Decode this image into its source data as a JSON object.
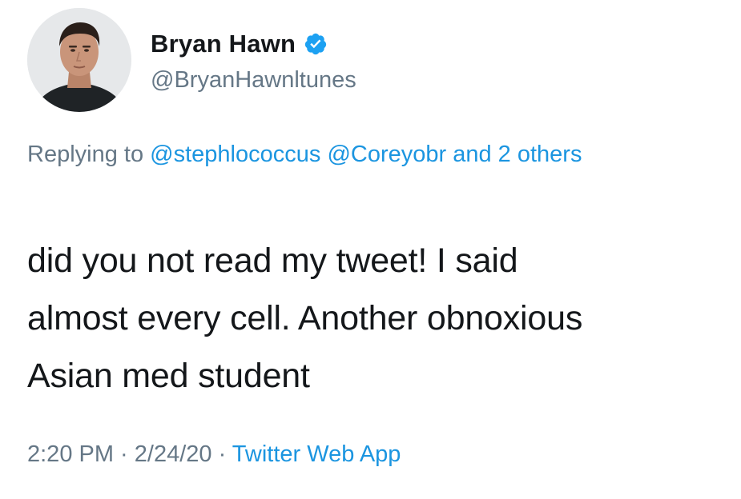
{
  "author": {
    "display_name": "Bryan Hawn",
    "handle": "@BryanHawnltunes",
    "verified": true,
    "avatar_icon": "profile-photo"
  },
  "reply_context": {
    "prefix": "Replying to ",
    "mention_1": "@stephlococcus",
    "mention_2": "@Coreyobr",
    "others": "and 2 others"
  },
  "tweet": {
    "line_1": "did you not read my tweet! I said",
    "line_2": "almost every cell. Another obnoxious",
    "line_3": "Asian med student"
  },
  "meta": {
    "time": "2:20 PM",
    "separator": " · ",
    "date": "2/24/20",
    "source": "Twitter Web App"
  },
  "colors": {
    "link": "#1b95e0",
    "secondary_text": "#657786",
    "primary_text": "#14171a",
    "verified_badge": "#1da1f2"
  }
}
